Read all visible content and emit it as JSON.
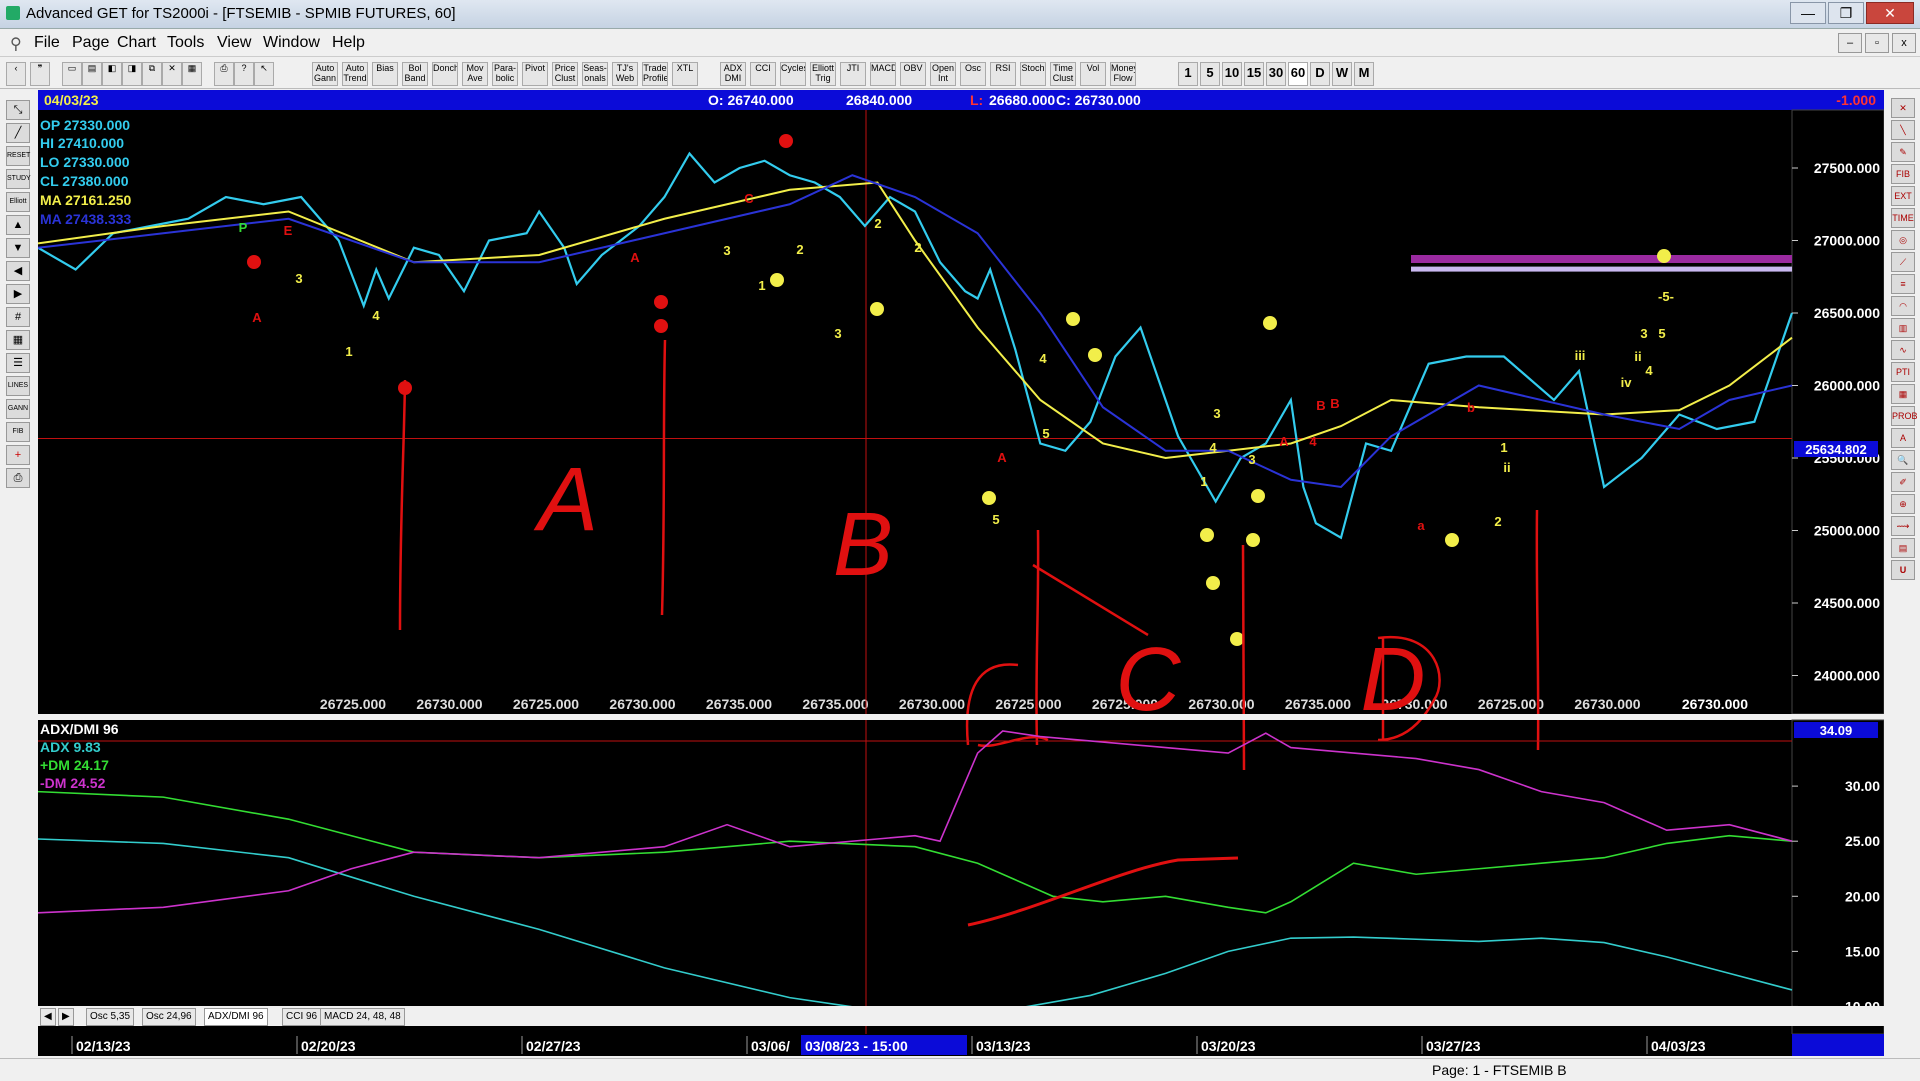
{
  "window": {
    "title": "Advanced GET for TS2000i - [FTSEMIB - SPMIB FUTURES, 60]",
    "buttons": [
      "—",
      "❐",
      "✕"
    ]
  },
  "menu": [
    "File",
    "Page",
    "Chart",
    "Tools",
    "View",
    "Window",
    "Help"
  ],
  "toolbar": {
    "study_buttons": [
      "Auto Gann",
      "Auto Trend",
      "Bias",
      "Bol Band",
      "Donch",
      "Mov Ave",
      "Para-bolic",
      "Pivot",
      "Price Clust",
      "Seas-onals",
      "TJ's Web",
      "Trade Profile",
      "XTL",
      "ADX DMI",
      "CCI",
      "Cycles",
      "Elliott Trig",
      "JTI",
      "MACD",
      "OBV",
      "Open Int",
      "Osc",
      "RSI",
      "Stoch",
      "Time Clust",
      "Vol",
      "Money Flow"
    ],
    "interval_buttons": [
      "1",
      "5",
      "10",
      "15",
      "30",
      "60",
      "D",
      "W",
      "M"
    ]
  },
  "chart_header": {
    "date": "04/03/23",
    "open": "O: 26740.000",
    "high": "26840.000",
    "low_label": "L:",
    "low": "26680.000",
    "close": "C: 26730.000",
    "change": "-1.000"
  },
  "price_info": {
    "op": "OP  27330.000",
    "hi": "HI   27410.000",
    "lo": "LO  27330.000",
    "cl": "CL  27380.000",
    "ma1": "MA  27161.250",
    "ma2": "MA  27438.333"
  },
  "crosshair_price": "25634.802",
  "bottom_value": "26730.000",
  "chart_data": [
    {
      "type": "line",
      "title": "FTSEMIB - SPMIB FUTURES, 60",
      "ylim": [
        23900,
        27900
      ],
      "y_ticks": [
        "27500.000",
        "27000.000",
        "26500.000",
        "26000.000",
        "25500.000",
        "25000.000",
        "24500.000",
        "24000.000"
      ],
      "x_labels": [
        "26725.000",
        "26730.000",
        "26725.000",
        "26730.000",
        "26735.000",
        "26735.000",
        "26730.000",
        "26725.000",
        "26725.000",
        "26730.000",
        "26735.000",
        "26730.000",
        "26725.000",
        "26730.000"
      ],
      "series": [
        {
          "color": "#33ccee",
          "x": [
            0,
            6,
            12,
            18,
            24,
            30,
            36,
            42,
            48,
            52,
            54,
            56,
            60,
            64,
            68,
            72,
            78,
            80,
            84,
            86,
            90,
            96,
            100,
            104,
            108,
            112,
            116,
            120,
            124,
            128,
            132,
            134,
            136,
            140,
            144,
            148,
            150,
            152,
            156,
            160,
            164,
            168,
            172,
            176,
            180,
            182,
            184,
            188,
            192,
            196,
            200,
            202,
            204,
            208,
            212,
            216,
            222,
            228,
            234,
            238,
            242,
            246,
            250,
            256,
            262,
            268,
            274,
            280
          ],
          "values": [
            26950,
            26800,
            27050,
            27100,
            27150,
            27300,
            27250,
            27300,
            27000,
            26550,
            26800,
            26600,
            26950,
            26900,
            26650,
            27000,
            27050,
            27200,
            26950,
            26700,
            26900,
            27100,
            27300,
            27600,
            27400,
            27500,
            27550,
            27450,
            27400,
            27300,
            27100,
            27200,
            27300,
            27200,
            26850,
            26650,
            26600,
            26800,
            26250,
            25600,
            25550,
            25750,
            26200,
            26400,
            25900,
            25650,
            25500,
            25200,
            25500,
            25600,
            25900,
            25300,
            25050,
            24950,
            25600,
            25550,
            26150,
            26200,
            26200,
            26050,
            25900,
            26100,
            25300,
            25500,
            25800,
            25700,
            25750,
            26500
          ]
        },
        {
          "name": "MA",
          "color": "#f2ee4a",
          "x": [
            0,
            20,
            40,
            60,
            80,
            100,
            120,
            134,
            140,
            150,
            160,
            170,
            180,
            190,
            200,
            208,
            216,
            230,
            250,
            262,
            270,
            280
          ],
          "values": [
            26980,
            27100,
            27200,
            26850,
            26900,
            27150,
            27350,
            27400,
            27000,
            26400,
            25900,
            25600,
            25500,
            25550,
            25600,
            25720,
            25900,
            25850,
            25800,
            25830,
            26000,
            26330
          ]
        },
        {
          "name": "MA",
          "color": "#2a33d6",
          "x": [
            0,
            20,
            40,
            60,
            80,
            100,
            120,
            130,
            140,
            150,
            160,
            170,
            180,
            190,
            200,
            208,
            216,
            230,
            250,
            262,
            270,
            280
          ],
          "values": [
            26950,
            27050,
            27150,
            26850,
            26850,
            27050,
            27250,
            27450,
            27300,
            27050,
            26500,
            25850,
            25550,
            25550,
            25350,
            25300,
            25650,
            26000,
            25800,
            25700,
            25900,
            26000
          ]
        }
      ]
    },
    {
      "type": "line",
      "title": "ADX/DMI 96",
      "ylim": [
        7.5,
        36
      ],
      "y_ticks": [
        "30.00",
        "25.00",
        "20.00",
        "15.00",
        "10.00"
      ],
      "current": "34.09",
      "legend": [
        "ADX 9.83",
        "+DM 24.17",
        "-DM  24.52"
      ],
      "series": [
        {
          "name": "ADX",
          "color": "#33cccc",
          "x": [
            0,
            20,
            40,
            60,
            80,
            100,
            120,
            132,
            144,
            156,
            168,
            180,
            190,
            200,
            210,
            220,
            230,
            240,
            250,
            260,
            270,
            280
          ],
          "values": [
            25.2,
            24.8,
            23.5,
            20,
            17,
            13.5,
            10.8,
            9.8,
            9.5,
            9.8,
            11,
            13,
            15,
            16.2,
            16.3,
            16.1,
            15.9,
            16.2,
            15.8,
            14.5,
            13,
            11.5
          ]
        },
        {
          "name": "+DM",
          "color": "#33dd33",
          "x": [
            0,
            20,
            40,
            60,
            80,
            100,
            120,
            140,
            150,
            156,
            162,
            170,
            180,
            190,
            196,
            200,
            210,
            220,
            230,
            240,
            250,
            260,
            270,
            280
          ],
          "values": [
            29.5,
            29,
            27,
            24,
            23.5,
            24,
            25,
            24.5,
            23,
            21.5,
            20,
            19.5,
            20,
            19,
            18.5,
            19.5,
            23,
            22,
            22.5,
            23,
            23.5,
            24.8,
            25.5,
            25
          ]
        },
        {
          "name": "-DM",
          "color": "#cc33cc",
          "x": [
            0,
            20,
            40,
            50,
            60,
            80,
            100,
            110,
            120,
            140,
            144,
            150,
            154,
            160,
            170,
            180,
            190,
            196,
            200,
            210,
            220,
            230,
            240,
            250,
            260,
            270,
            280
          ],
          "values": [
            18.5,
            19,
            20.5,
            22.5,
            24,
            23.5,
            24.5,
            26.5,
            24.5,
            25.5,
            25,
            33,
            35,
            34.5,
            34,
            33.5,
            33,
            34.8,
            33.5,
            33,
            32.5,
            31.5,
            29.5,
            28.5,
            26,
            26.5,
            25
          ]
        }
      ]
    }
  ],
  "date_axis": [
    "02/13/23",
    "02/20/23",
    "02/27/23",
    "03/06/",
    "03/13/23",
    "03/20/23",
    "03/27/23",
    "04/03/23"
  ],
  "cursor_date": "03/08/23 - 15:00",
  "wave_labels": [
    "P",
    "E",
    "A",
    "A",
    "C",
    "2",
    "2",
    "2",
    "4",
    "3",
    "1",
    "3",
    "1",
    "3",
    "4",
    "5",
    "3",
    "4",
    "1",
    "4",
    "A",
    "B",
    "5",
    "3",
    "A",
    "B",
    "a",
    "b",
    "1",
    "2",
    "ii",
    "iii",
    "iv",
    "3",
    "4",
    "5",
    "-5-",
    "ii"
  ],
  "annotations": [
    "A",
    "B",
    "C",
    "D"
  ],
  "tabs": [
    "Osc 5,35",
    "Osc 24,96",
    "ADX/DMI 96",
    "CCI 96",
    "MACD 24, 48, 48"
  ],
  "status": "Page: 1 - FTSEMIB B",
  "colors": {
    "chart_bg": "#000000",
    "price": "#33ccee",
    "ma_fast": "#f2ee4a",
    "ma_slow": "#2a33d6",
    "header": "#0b0bd8",
    "annotation": "#e01010",
    "wave": "#f2ee4a"
  }
}
